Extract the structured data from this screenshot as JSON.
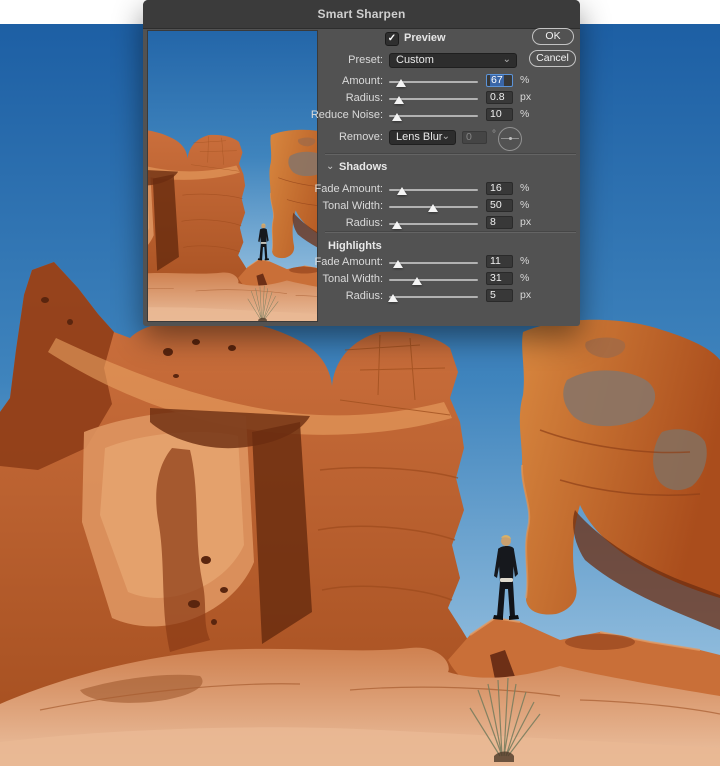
{
  "window": {
    "title": "Smart Sharpen"
  },
  "icons": {
    "check": "✓",
    "chevron_down": "⌄"
  },
  "dialog": {
    "preview": {
      "label": "Preview",
      "checked": true
    },
    "buttons": {
      "ok": "OK",
      "cancel": "Cancel"
    },
    "preset": {
      "label": "Preset:",
      "value": "Custom"
    },
    "main_sliders": [
      {
        "label": "Amount:",
        "value": "67",
        "unit": "%",
        "pct": 14
      },
      {
        "label": "Radius:",
        "value": "0.8",
        "unit": "px",
        "pct": 11
      },
      {
        "label": "Reduce Noise:",
        "value": "10",
        "unit": "%",
        "pct": 9
      }
    ],
    "remove": {
      "label": "Remove:",
      "value": "Lens Blur",
      "angle": "0",
      "angle_unit": "°"
    },
    "shadows": {
      "title": "Shadows",
      "sliders": [
        {
          "label": "Fade Amount:",
          "value": "16",
          "unit": "%",
          "pct": 15
        },
        {
          "label": "Tonal Width:",
          "value": "50",
          "unit": "%",
          "pct": 49
        },
        {
          "label": "Radius:",
          "value": "8",
          "unit": "px",
          "pct": 9
        }
      ]
    },
    "highlights": {
      "title": "Highlights",
      "sliders": [
        {
          "label": "Fade Amount:",
          "value": "11",
          "unit": "%",
          "pct": 10
        },
        {
          "label": "Tonal Width:",
          "value": "31",
          "unit": "%",
          "pct": 31
        },
        {
          "label": "Radius:",
          "value": "5",
          "unit": "px",
          "pct": 5
        }
      ]
    },
    "colors": {
      "focus_blue": "#5b93d8",
      "selection_blue": "#3a66a8",
      "dialog_bg": "#525252",
      "titlebar_bg": "#3b3b3b"
    }
  }
}
